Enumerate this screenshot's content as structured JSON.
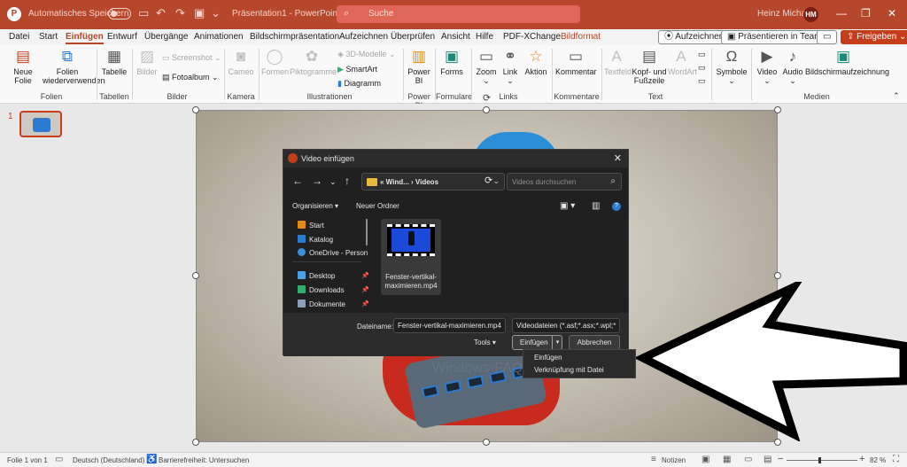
{
  "titlebar": {
    "autosave_label": "Automatisches Speichern",
    "filename": "Präsentation1 - PowerPoint",
    "search_placeholder": "Suche",
    "user_name": "Heinz Michael",
    "user_initials": "HM"
  },
  "menu": {
    "tabs": [
      "Datei",
      "Start",
      "Einfügen",
      "Entwurf",
      "Übergänge",
      "Animationen",
      "Bildschirmpräsentation",
      "Aufzeichnen",
      "Überprüfen",
      "Ansicht",
      "Hilfe",
      "PDF-XChange",
      "Bildformat"
    ],
    "active_tab": "Einfügen",
    "record_button": "Aufzeichnen",
    "teams_button": "Präsentieren in Teams",
    "share_button": "Freigeben"
  },
  "ribbon": {
    "new_slide": "Neue Folie",
    "reuse_slides": "Folien wiederverwenden",
    "table": "Tabelle",
    "images": "Bilder",
    "screenshot": "Screenshot",
    "photo_album": "Fotoalbum",
    "cameo": "Cameo",
    "shapes": "Formen",
    "pictograms": "Piktogramme",
    "models_3d": "3D-Modelle",
    "smartart": "SmartArt",
    "chart": "Diagramm",
    "power_bi": "Power BI",
    "forms": "Forms",
    "zoom": "Zoom",
    "link": "Link",
    "action": "Aktion",
    "comment": "Kommentar",
    "textfield": "Textfeld",
    "header_footer": "Kopf- und Fußzeile",
    "wordart": "WordArt",
    "symbols": "Symbole",
    "video": "Video",
    "audio": "Audio",
    "screen_recording": "Bildschirmaufzeichnung",
    "groups": {
      "slides": "Folien",
      "tables": "Tabellen",
      "images": "Bilder",
      "camera": "Kamera",
      "illustrations": "Illustrationen",
      "power_bi": "Power BI",
      "forms": "Formulare",
      "links": "Links",
      "comments": "Kommentare",
      "text": "Text",
      "media": "Medien"
    }
  },
  "thumbnails": {
    "slide_number": "1"
  },
  "slide": {
    "watermark": "Windows-FAQ"
  },
  "dialog": {
    "title": "Video einfügen",
    "address_path": "« Wind... › Videos",
    "search_placeholder": "Videos durchsuchen",
    "organize": "Organisieren",
    "new_folder": "Neuer Ordner",
    "nav": [
      {
        "label": "Start",
        "color": "#e38a17"
      },
      {
        "label": "Katalog",
        "color": "#2b7bd0"
      },
      {
        "label": "OneDrive - Person",
        "color": "#3d8fe0"
      },
      {
        "label": "Desktop",
        "color": "#4aa3e8"
      },
      {
        "label": "Downloads",
        "color": "#2fae6d"
      },
      {
        "label": "Dokumente",
        "color": "#8aa0b8"
      }
    ],
    "file_name": "Fenster-vertikal-maximieren.mp4",
    "file_label": "Dateiname:",
    "file_value": "Fenster-vertikal-maximieren.mp4",
    "file_type": "Videodateien (*.asf;*.asx;*.wpl;*",
    "tools": "Tools",
    "insert": "Einfügen",
    "cancel": "Abbrechen",
    "dropdown_items": [
      "Einfügen",
      "Verknüpfung mit Datei"
    ]
  },
  "statusbar": {
    "slide_info": "Folie 1 von 1",
    "language": "Deutsch (Deutschland)",
    "accessibility": "Barrierefreiheit: Untersuchen",
    "notes": "Notizen",
    "zoom": "82 %",
    "zoom_fraction": 0.45
  }
}
